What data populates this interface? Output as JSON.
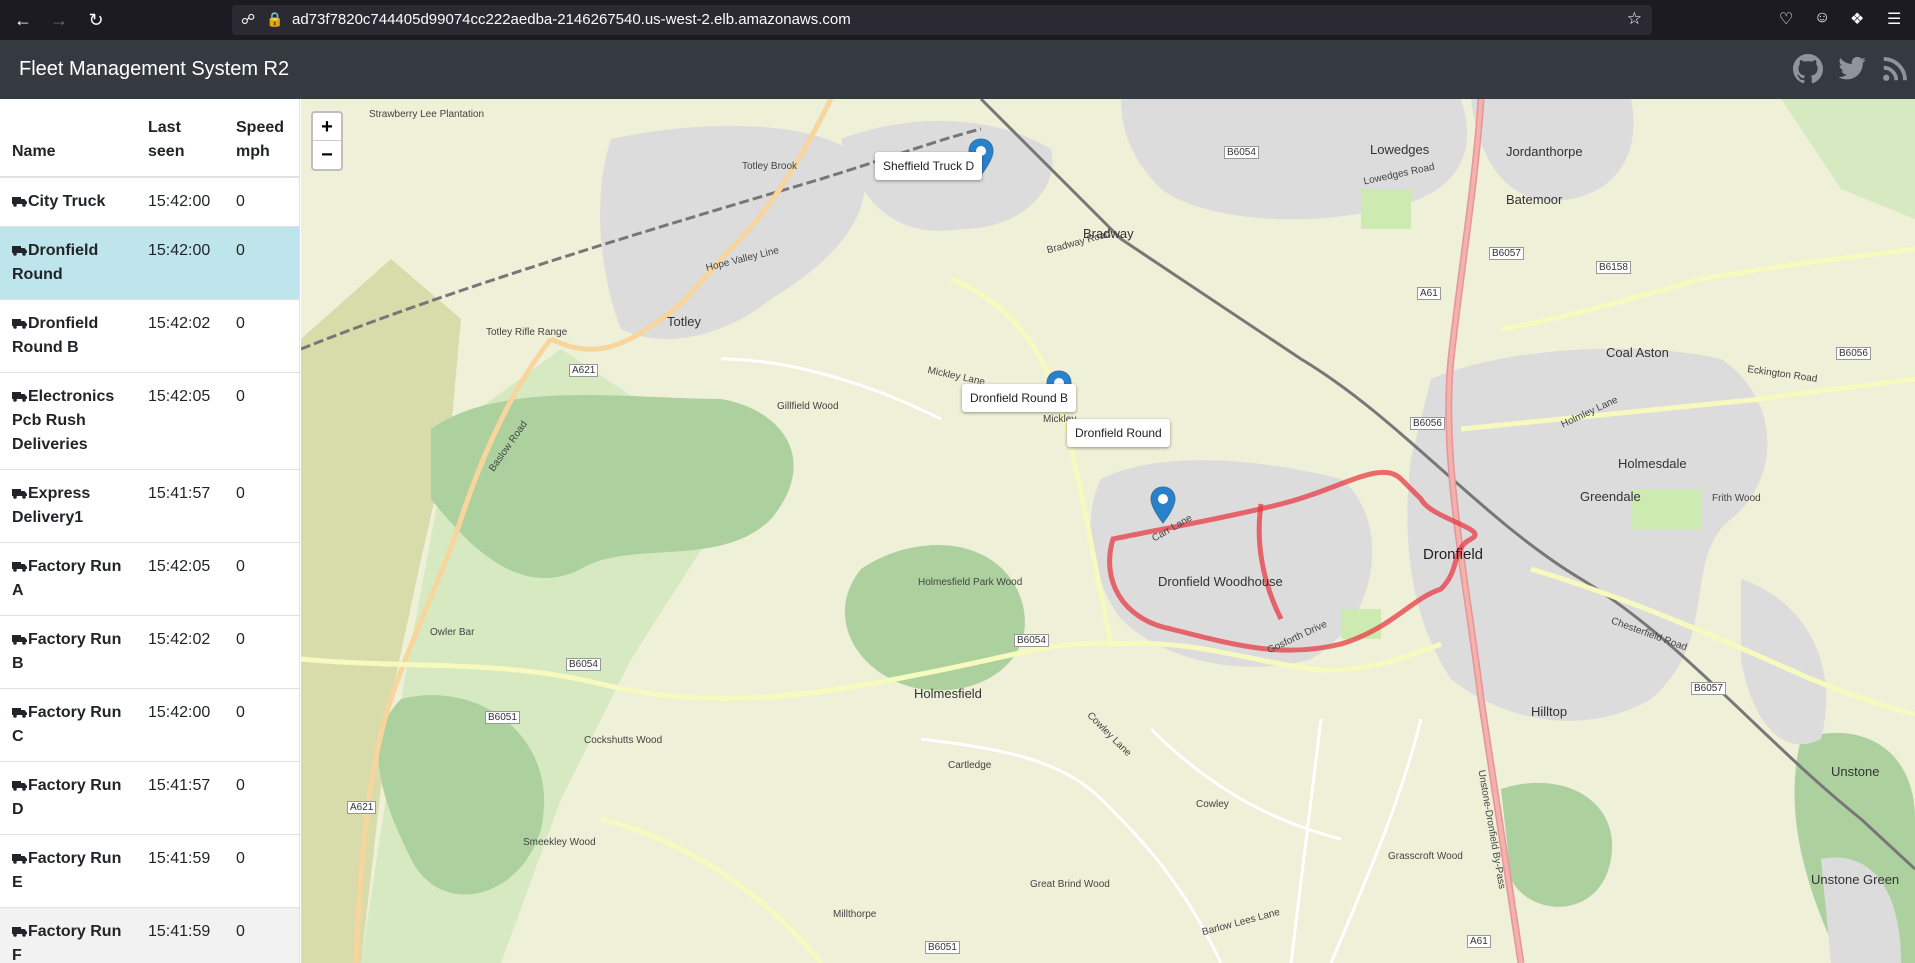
{
  "browser": {
    "url": "ad73f7820c744405d99074cc222aedba-2146267540.us-west-2.elb.amazonaws.com"
  },
  "app": {
    "title": "Fleet Management System R2",
    "icons": [
      "github-icon",
      "twitter-icon",
      "rss-icon"
    ]
  },
  "table": {
    "headers": {
      "name": "Name",
      "last_seen": "Last seen",
      "speed": "Speed mph"
    },
    "rows": [
      {
        "name": "City Truck",
        "last_seen": "15:42:00",
        "speed": "0"
      },
      {
        "name": "Dronfield Round",
        "last_seen": "15:42:00",
        "speed": "0"
      },
      {
        "name": "Dronfield Round B",
        "last_seen": "15:42:02",
        "speed": "0"
      },
      {
        "name": "Electronics Pcb Rush Deliveries",
        "last_seen": "15:42:05",
        "speed": "0"
      },
      {
        "name": "Express Delivery1",
        "last_seen": "15:41:57",
        "speed": "0"
      },
      {
        "name": "Factory Run A",
        "last_seen": "15:42:05",
        "speed": "0"
      },
      {
        "name": "Factory Run B",
        "last_seen": "15:42:02",
        "speed": "0"
      },
      {
        "name": "Factory Run C",
        "last_seen": "15:42:00",
        "speed": "0"
      },
      {
        "name": "Factory Run D",
        "last_seen": "15:41:57",
        "speed": "0"
      },
      {
        "name": "Factory Run E",
        "last_seen": "15:41:59",
        "speed": "0"
      },
      {
        "name": "Factory Run F",
        "last_seen": "15:41:59",
        "speed": "0"
      }
    ]
  },
  "map": {
    "zoom_in": "+",
    "zoom_out": "−",
    "markers": [
      {
        "label": "Sheffield Truck D"
      },
      {
        "label": "Dronfield Round B"
      },
      {
        "label": "Dronfield Round"
      }
    ],
    "places": {
      "totley": "Totley",
      "bradway": "Bradway",
      "lowedges": "Lowedges",
      "jordanthorpe": "Jordanthorpe",
      "batemoor": "Batemoor",
      "coal_aston": "Coal Aston",
      "holmesdale": "Holmesdale",
      "greendale": "Greendale",
      "dronfield": "Dronfield",
      "dronfield_woodhouse": "Dronfield Woodhouse",
      "holmesfield": "Holmesfield",
      "hilltop": "Hilltop",
      "unstone": "Unstone",
      "unstone_green": "Unstone Green",
      "mickley": "Mickley",
      "cartledge": "Cartledge",
      "cowley": "Cowley",
      "millthorpe": "Millthorpe",
      "owler_bar": "Owler Bar",
      "totley_brook": "Totley Brook",
      "holmesfield_park_wood": "Holmesfield Park Wood",
      "great_brind_wood": "Great Brind Wood",
      "smeekley_wood": "Smeekley Wood",
      "cockshutts_wood": "Cockshutts Wood",
      "gillfield_wood": "Gillfield Wood",
      "frith_wood": "Frith Wood",
      "grasscroft_wood": "Grasscroft Wood",
      "totley_rifle_range": "Totley Rifle Range",
      "lee_plantation": "Strawberry Lee Plantation"
    },
    "roads": {
      "a621": "A621",
      "a621b": "A621",
      "b6054": "B6054",
      "b6054b": "B6054",
      "b6054c": "B6054",
      "b6051": "B6051",
      "b6051b": "B6051",
      "b6057": "B6057",
      "b6057b": "B6057",
      "b6158": "B6158",
      "b6056": "B6056",
      "b6056b": "B6056",
      "a61": "A61",
      "a61b": "A61",
      "mickley_lane": "Mickley Lane",
      "lowedges_road": "Lowedges Road",
      "bradway_road": "Bradway Road",
      "carr_lane": "Carr Lane",
      "gosforth_drive": "Gosforth Drive",
      "cowley_lane": "Cowley Lane",
      "holmley_lane": "Holmley Lane",
      "chesterfield_road": "Chesterfield Road",
      "eckington_road": "Eckington Road",
      "hope_valley_line": "Hope Valley Line",
      "baslow_road": "Baslow Road",
      "unstone_bypass": "Unstone-Dronfield By-Pass",
      "barlow_lees_lane": "Barlow Lees Lane"
    }
  }
}
